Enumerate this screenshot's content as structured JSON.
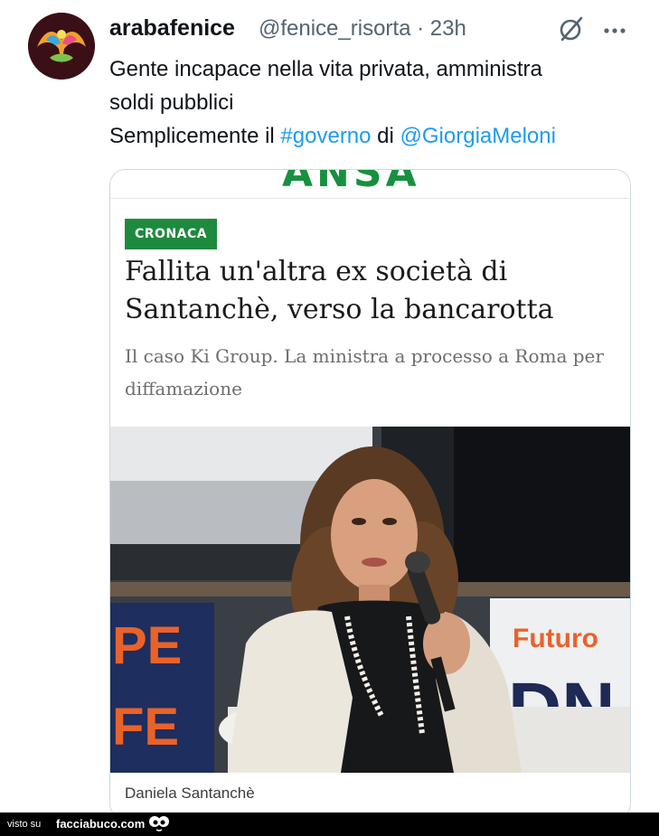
{
  "tweet": {
    "display_name": "arabafenice",
    "handle": "@fenice_risorta",
    "separator": "·",
    "time": "23h",
    "text_line1": "Gente incapace nella vita privata, amministra",
    "text_line2": "soldi pubblici",
    "text_line3_prefix": "Semplicemente il ",
    "hashtag": "#governo",
    "text_line3_mid": " di ",
    "mention": "@GiorgiaMeloni",
    "icons": {
      "grok": "grok-slash-icon",
      "more": "more-dots-icon"
    }
  },
  "card": {
    "logo": "ANSA",
    "category": "CRONACA",
    "headline": "Fallita un'altra ex società di Santanchè, verso la bancarotta",
    "subhead": "Il caso Ki Group. La ministra a processo a Roma per diffamazione",
    "photo_sign_left": "PE",
    "photo_sign_left_2": "FE",
    "photo_sign_right": "Futuro",
    "photo_sign_right_big": "DN",
    "caption": "Daniela Santanchè"
  },
  "footer": {
    "visto": "visto su",
    "brand": "facciabuco.com"
  },
  "colors": {
    "link": "#1d9bf0",
    "muted": "#536471",
    "ansa_green": "#1e8a3d"
  }
}
